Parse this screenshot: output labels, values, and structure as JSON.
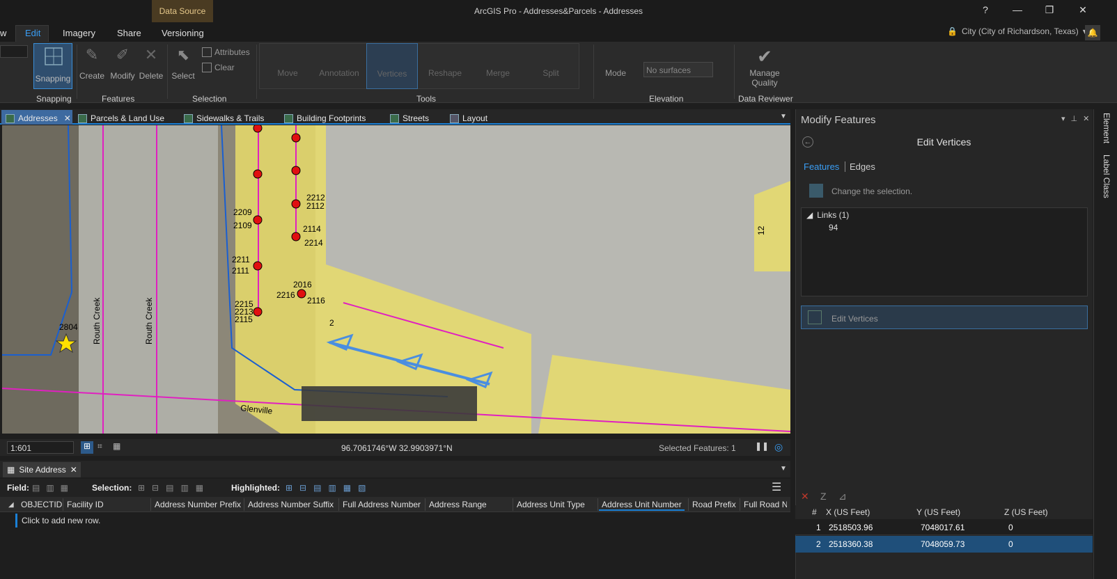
{
  "window": {
    "title": "ArcGIS Pro - Addresses&Parcels - Addresses",
    "context_tab": "Data Source",
    "help": "?",
    "minimize": "—",
    "restore": "❐",
    "close": "✕"
  },
  "ribbon_tabs": [
    "w",
    "Edit",
    "Imagery",
    "Share",
    "Versioning"
  ],
  "portal": "City (City of Richardson, Texas)",
  "ribbon": {
    "snapping": "Snapping",
    "create": "Create",
    "modify": "Modify",
    "delete": "Delete",
    "select": "Select",
    "attributes": "Attributes",
    "clear": "Clear",
    "move": "Move",
    "annotation": "Annotation",
    "vertices": "Vertices",
    "reshape": "Reshape",
    "merge": "Merge",
    "split": "Split",
    "mode": "Mode",
    "surface_placeholder": "No surfaces",
    "manage": "Manage",
    "quality": "Quality",
    "groups": {
      "snapping": "Snapping",
      "features": "Features",
      "selection": "Selection",
      "tools": "Tools",
      "elevation": "Elevation",
      "data_reviewer": "Data Reviewer"
    }
  },
  "map_tabs": [
    "Addresses",
    "Parcels & Land Use",
    "Sidewalks & Trails",
    "Building Footprints",
    "Streets",
    "Layout"
  ],
  "map": {
    "street_labels": [
      "Routh Creek",
      "Routh Creek",
      "Glenville"
    ],
    "address_labels": [
      "2804",
      "2209",
      "2109",
      "2212",
      "2112",
      "2114",
      "2214",
      "2211",
      "2111",
      "2016",
      "2216",
      "2116",
      "2215",
      "2213",
      "2115",
      "2",
      "12"
    ]
  },
  "status": {
    "scale": "1:601",
    "coords": "96.7061746°W 32.9903971°N",
    "selected": "Selected Features: 1"
  },
  "attribute_table": {
    "title": "Site Address",
    "field_label": "Field:",
    "selection_label": "Selection:",
    "highlighted_label": "Highlighted:",
    "columns": [
      "OBJECTID",
      "Facility ID",
      "Address Number Prefix",
      "Address Number Suffix",
      "Full Address Number",
      "Address Range",
      "Address Unit Type",
      "Address Unit Number",
      "Road Prefix",
      "Full Road Na"
    ],
    "add_row": "Click to add new row."
  },
  "modify_pane": {
    "title": "Modify Features",
    "tool_title": "Edit Vertices",
    "tab_features": "Features",
    "tab_edges": "Edges",
    "change_selection": "Change the selection.",
    "tree_root": "Links (1)",
    "tree_child": "94",
    "edit_vertices_row": "Edit Vertices",
    "vertex_table": {
      "headers": [
        "#",
        "X (US Feet)",
        "Y (US Feet)",
        "Z (US Feet)"
      ],
      "rows": [
        {
          "n": "1",
          "x": "2518503.96",
          "y": "7048017.61",
          "z": "0"
        },
        {
          "n": "2",
          "x": "2518360.38",
          "y": "7048059.73",
          "z": "0"
        }
      ]
    }
  },
  "side_tabs": [
    "Element",
    "Label Class"
  ],
  "colors": {
    "accent": "#1a80d6",
    "parcel": "#e8dc6a",
    "selected_row": "#1f4f7a"
  }
}
